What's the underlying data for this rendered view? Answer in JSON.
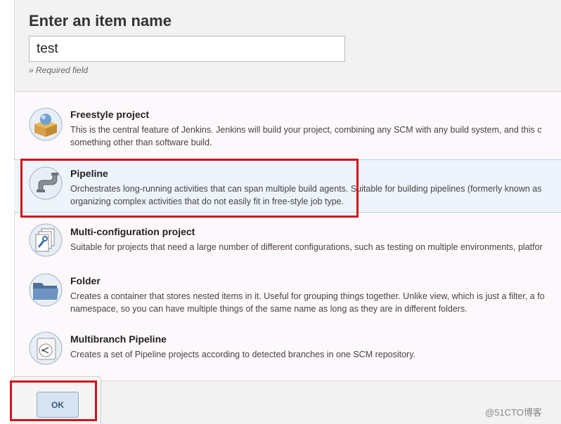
{
  "form": {
    "heading": "Enter an item name",
    "item_name_value": "test",
    "required_note": "» Required field"
  },
  "item_types": [
    {
      "title": "Freestyle project",
      "desc_line1": "This is the central feature of Jenkins. Jenkins will build your project, combining any SCM with any build system, and this c",
      "desc_line2": "something other than software build.",
      "icon": "freestyle-box-icon"
    },
    {
      "title": "Pipeline",
      "desc_line1": "Orchestrates long-running activities that can span multiple build agents. Suitable for building pipelines (formerly known as",
      "desc_line2": "organizing complex activities that do not easily fit in free-style job type.",
      "icon": "pipeline-pipe-icon",
      "selected": true
    },
    {
      "title": "Multi-configuration project",
      "desc_line1": "Suitable for projects that need a large number of different configurations, such as testing on multiple environments, platfor",
      "icon": "multi-config-icon"
    },
    {
      "title": "Folder",
      "desc_line1": "Creates a container that stores nested items in it. Useful for grouping things together. Unlike view, which is just a filter, a fo",
      "desc_line2": "namespace, so you can have multiple things of the same name as long as they are in different folders.",
      "icon": "folder-icon"
    },
    {
      "title": "Multibranch Pipeline",
      "desc_line1": "Creates a set of Pipeline projects according to detected branches in one SCM repository.",
      "icon": "multibranch-icon"
    }
  ],
  "actions": {
    "ok_label": "OK"
  },
  "watermark": "@51CTO博客",
  "colors": {
    "highlight": "#d3121b",
    "selected_bg": "#eef4fb",
    "ok_button": "#d6e4f2"
  }
}
